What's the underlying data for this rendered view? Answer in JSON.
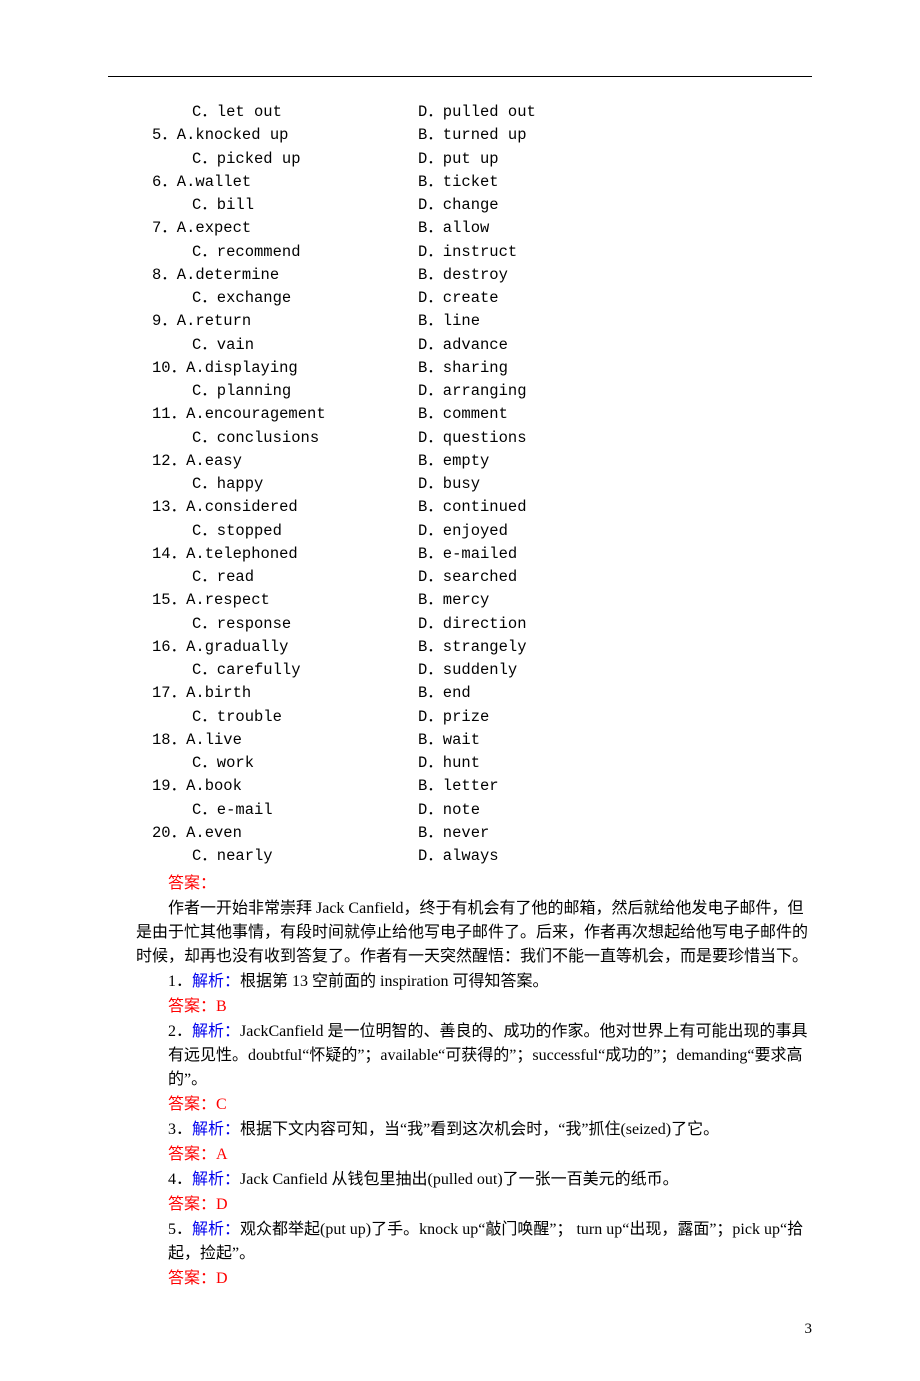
{
  "options": [
    {
      "indent": true,
      "a": "C．let out",
      "b": "D．pulled out"
    },
    {
      "indent": false,
      "a": "5．A.knocked up",
      "b": "B．turned up"
    },
    {
      "indent": true,
      "a": "C．picked up",
      "b": "D．put up"
    },
    {
      "indent": false,
      "a": "6．A.wallet",
      "b": "B．ticket"
    },
    {
      "indent": true,
      "a": "C．bill",
      "b": "D．change"
    },
    {
      "indent": false,
      "a": "7．A.expect",
      "b": "B．allow"
    },
    {
      "indent": true,
      "a": "C．recommend",
      "b": "D．instruct"
    },
    {
      "indent": false,
      "a": "8．A.determine",
      "b": "B．destroy"
    },
    {
      "indent": true,
      "a": "C．exchange",
      "b": "D．create"
    },
    {
      "indent": false,
      "a": "9．A.return",
      "b": "B．line"
    },
    {
      "indent": true,
      "a": "C．vain",
      "b": "D．advance"
    },
    {
      "indent": false,
      "a": "10．A.displaying",
      "b": "B．sharing"
    },
    {
      "indent": true,
      "a": "C．planning",
      "b": "D．arranging"
    },
    {
      "indent": false,
      "a": "11．A.encouragement",
      "b": "B．comment"
    },
    {
      "indent": true,
      "a": "C．conclusions",
      "b": "D．questions"
    },
    {
      "indent": false,
      "a": "12．A.easy",
      "b": "B．empty"
    },
    {
      "indent": true,
      "a": "C．happy",
      "b": "D．busy"
    },
    {
      "indent": false,
      "a": "13．A.considered",
      "b": "B．continued"
    },
    {
      "indent": true,
      "a": "C．stopped",
      "b": "D．enjoyed"
    },
    {
      "indent": false,
      "a": "14．A.telephoned",
      "b": "B．e-mailed"
    },
    {
      "indent": true,
      "a": "C．read",
      "b": "D．searched"
    },
    {
      "indent": false,
      "a": "15．A.respect",
      "b": "B．mercy"
    },
    {
      "indent": true,
      "a": "C．response",
      "b": "D．direction"
    },
    {
      "indent": false,
      "a": "16．A.gradually",
      "b": "B．strangely"
    },
    {
      "indent": true,
      "a": "C．carefully",
      "b": "D．suddenly"
    },
    {
      "indent": false,
      "a": "17．A.birth",
      "b": "B．end"
    },
    {
      "indent": true,
      "a": "C．trouble",
      "b": "D．prize"
    },
    {
      "indent": false,
      "a": "18．A.live",
      "b": "B．wait"
    },
    {
      "indent": true,
      "a": "C．work",
      "b": "D．hunt"
    },
    {
      "indent": false,
      "a": "19．A.book",
      "b": "B．letter"
    },
    {
      "indent": true,
      "a": "C．e-mail",
      "b": "D．note"
    },
    {
      "indent": false,
      "a": "20．A.even",
      "b": "B．never"
    },
    {
      "indent": true,
      "a": "C．nearly",
      "b": "D．always"
    }
  ],
  "answer_label": "答案：",
  "passage_p1": "作者一开始非常崇拜 Jack Canfield，终于有机会有了他的邮箱，然后就给他发电子邮件，但是由于忙其他事情，有段时间就停止给他写电子邮件了。后来，作者再次想起给他写电子邮件的时候，却再也没有收到答复了。作者有一天突然醒悟：我们不能一直等机会，而是要珍惜当下。",
  "explanations": [
    {
      "label": "1．",
      "jx": "解析：",
      "body": "根据第 13 空前面的 inspiration 可得知答案。",
      "ans": "答案：B"
    },
    {
      "label": "2．",
      "jx": "解析：",
      "body": "JackCanfield 是一位明智的、善良的、成功的作家。他对世界上有可能出现的事具有远见性。doubtful“怀疑的”；available“可获得的”；successful“成功的”；demanding“要求高的”。",
      "ans": "答案：C"
    },
    {
      "label": "3．",
      "jx": "解析：",
      "body": "根据下文内容可知，当“我”看到这次机会时，“我”抓住(seized)了它。",
      "ans": "答案：A"
    },
    {
      "label": "4．",
      "jx": "解析：",
      "body": "Jack Canfield 从钱包里抽出(pulled out)了一张一百美元的纸币。",
      "ans": "答案：D"
    },
    {
      "label": "5．",
      "jx": "解析：",
      "body": "观众都举起(put up)了手。knock up“敲门唤醒”； turn up“出现，露面”；pick up“拾起，捡起”。",
      "ans": "答案：D"
    }
  ],
  "page_number": "3"
}
